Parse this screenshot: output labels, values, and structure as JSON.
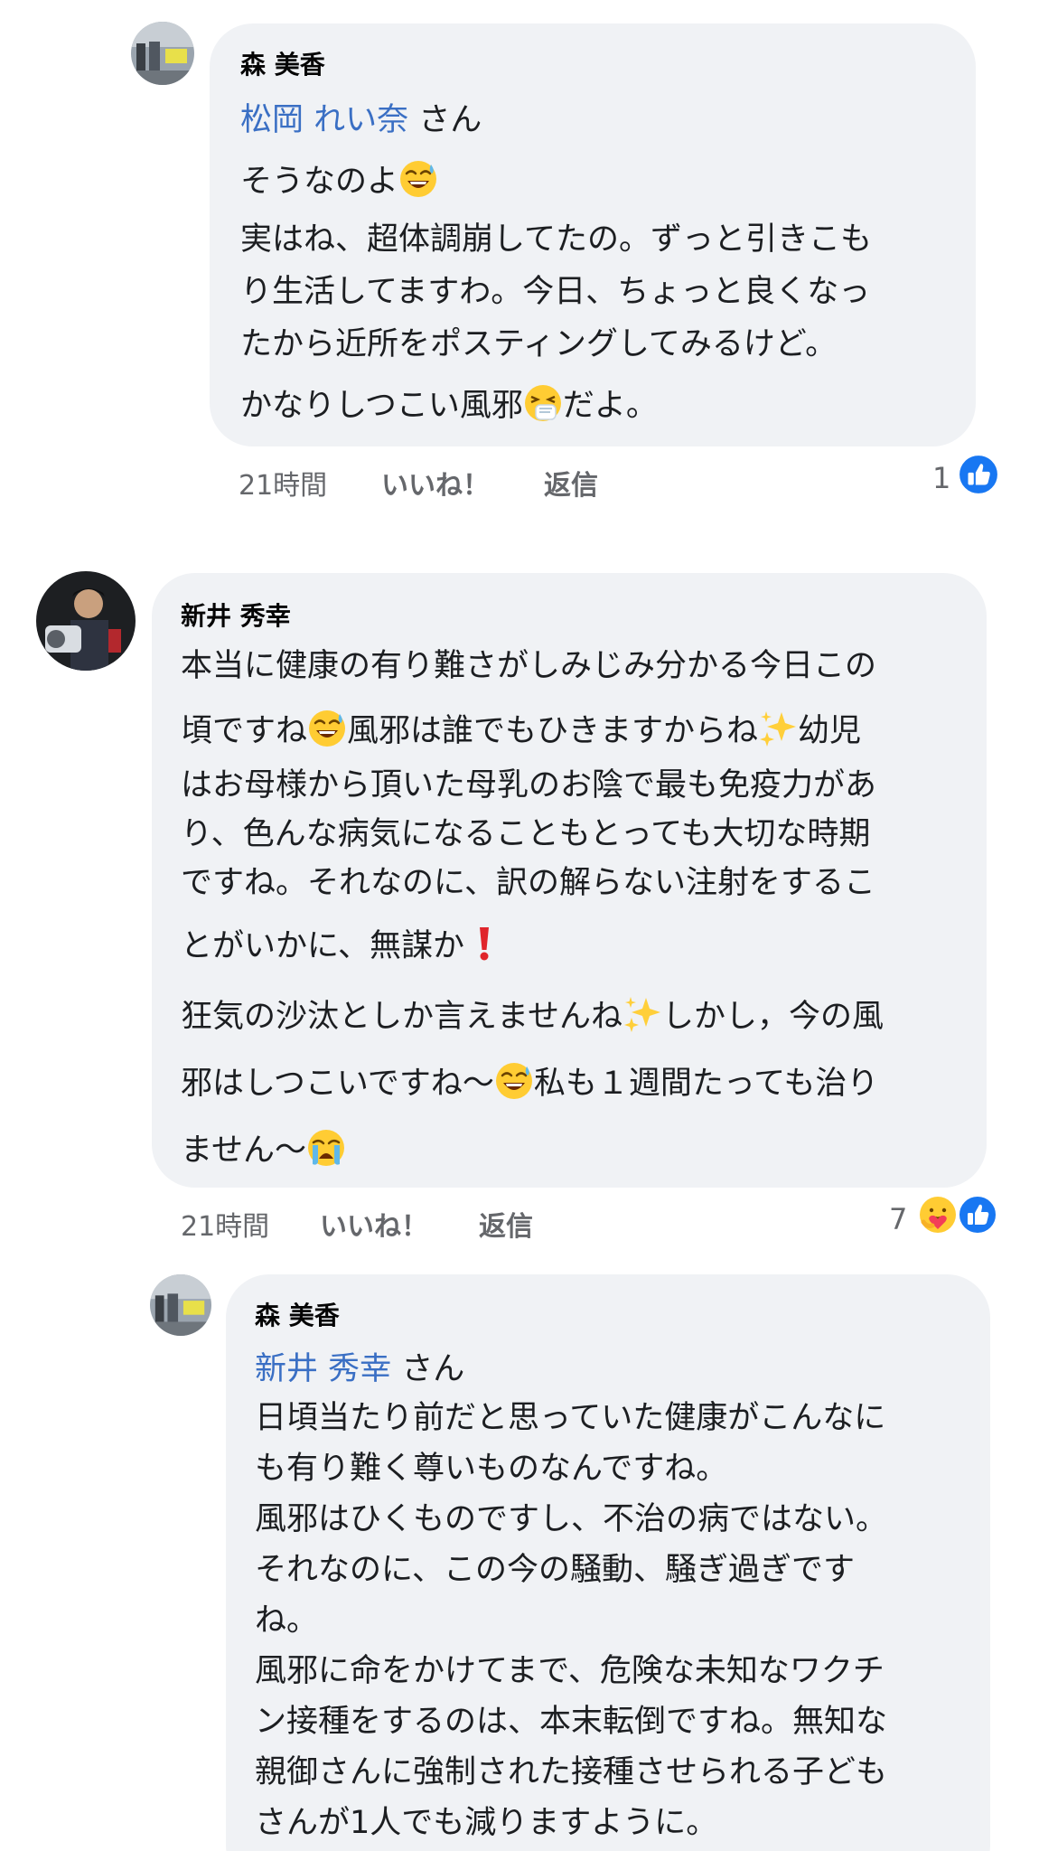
{
  "comments": [
    {
      "author": "森 美香",
      "mention": "松岡 れい奈",
      "mention_suffix": "さん",
      "lines": [
        "そうなのよ",
        "実はね、超体調崩してたの。ずっと引きこも",
        "り生活してますわ。今日、ちょっと良くなっ",
        "たから近所をポスティングしてみるけど。",
        "かなりしつこい風邪",
        "だよ。"
      ],
      "time": "21時間",
      "like_label": "いいね！",
      "reply_label": "返信",
      "reaction_count": "1"
    },
    {
      "author": "新井 秀幸",
      "lines": [
        "本当に健康の有り難さがしみじみ分かる今日この",
        "頃ですね",
        "風邪は誰でもひきますからね",
        "幼児",
        "はお母様から頂いた母乳のお陰で最も免疫力があ",
        "り、色んな病気になることもとっても大切な時期",
        "ですね。それなのに、訳の解らない注射をするこ",
        "とがいかに、無謀か",
        "狂気の沙汰としか言えませんね",
        "しかし，今の風",
        "邪はしつこいですね〜",
        "私も１週間たっても治り",
        "ません〜"
      ],
      "time": "21時間",
      "like_label": "いいね！",
      "reply_label": "返信",
      "reaction_count": "7"
    },
    {
      "author": "森 美香",
      "mention": "新井 秀幸",
      "mention_suffix": "さん",
      "lines": [
        "日頃当たり前だと思っていた健康がこんなに",
        "も有り難く尊いものなんですね。",
        "風邪はひくものですし、不治の病ではない。",
        "それなのに、この今の騒動、騒ぎ過ぎです",
        "ね。",
        "風邪に命をかけてまで、危険な未知なワクチ",
        "ン接種をするのは、本末転倒ですね。無知な",
        "親御さんに強制された接種させられる子ども",
        "さんが1人でも減りますように。"
      ]
    }
  ],
  "icons": {
    "like": "thumbs-up-icon",
    "care": "care-hug-icon",
    "sweat_smile": "grinning-sweat-emoji",
    "sneeze": "sneezing-face-emoji",
    "sparkles": "sparkles-emoji",
    "exclamation": "red-exclamation-emoji",
    "crying": "loudly-crying-emoji"
  },
  "colors": {
    "bubble": "#f0f2f5",
    "mention": "#3a6fc4",
    "meta": "#65676b",
    "like_blue": "#1877f2"
  }
}
